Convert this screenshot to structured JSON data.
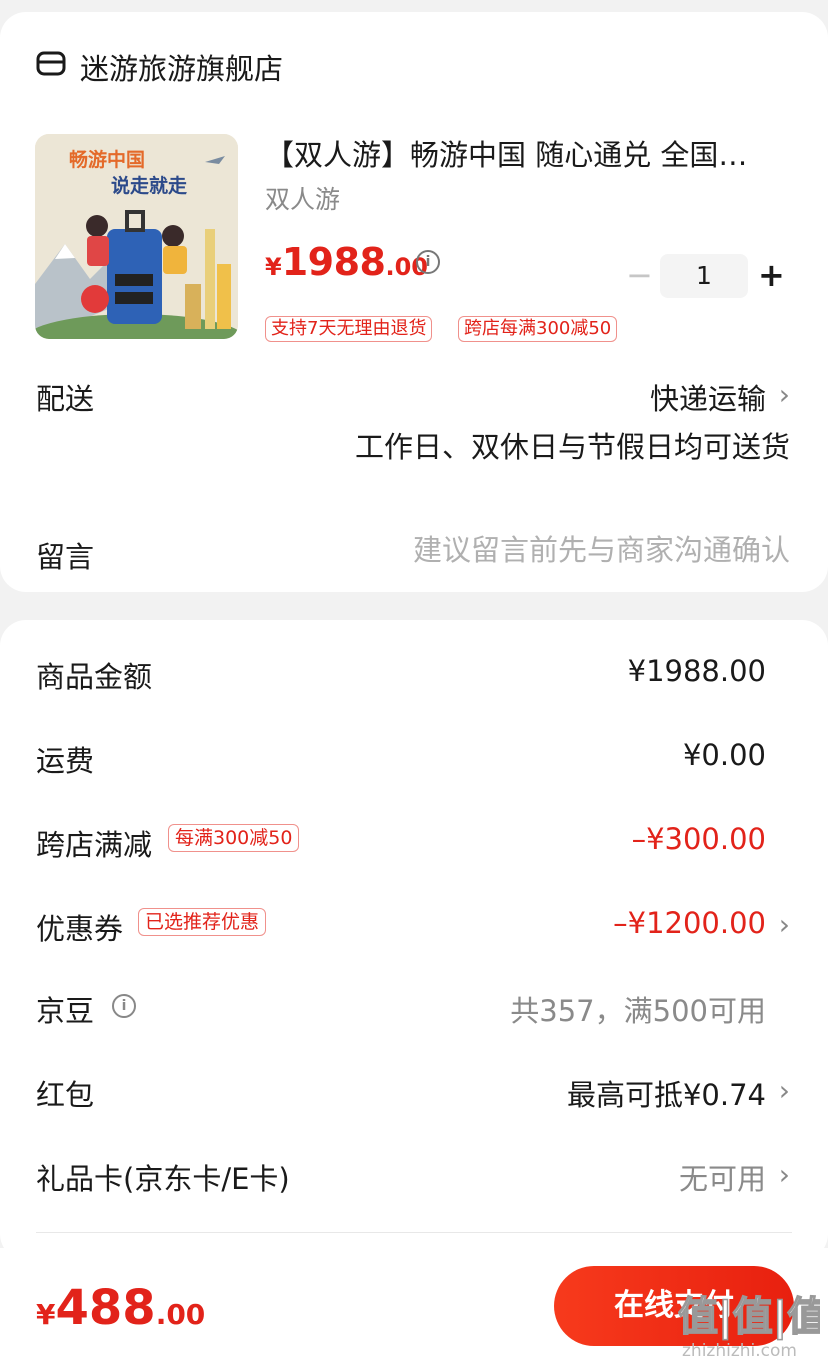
{
  "store": {
    "name": "迷游旅游旗舰店",
    "icon": "store-icon"
  },
  "product": {
    "title": "【双人游】畅游中国 随心通兑 全国…",
    "spec": "双人游",
    "price_currency": "¥",
    "price_int": "1988",
    "price_dec": ".00",
    "image_text_line1": "畅游中国",
    "image_text_line2": "说走就走",
    "quantity": "1",
    "tags": [
      "支持7天无理由退货",
      "跨店每满300减50"
    ]
  },
  "delivery": {
    "label": "配送",
    "value": "快递运输",
    "note": "工作日、双休日与节假日均可送货"
  },
  "message": {
    "label": "留言",
    "placeholder": "建议留言前先与商家沟通确认"
  },
  "summary": {
    "goods_amount": {
      "label": "商品金额",
      "value": "¥1988.00"
    },
    "shipping": {
      "label": "运费",
      "value": "¥0.00"
    },
    "cross_store": {
      "label": "跨店满减",
      "tag": "每满300减50",
      "value": "–¥300.00"
    },
    "coupon": {
      "label": "优惠券",
      "tag": "已选推荐优惠",
      "value": "–¥1200.00"
    },
    "jd_beans": {
      "label": "京豆",
      "value": "共357，满500可用"
    },
    "red_packet": {
      "label": "红包",
      "value": "最高可抵¥0.74"
    },
    "gift_card": {
      "label": "礼品卡(京东卡/E卡)",
      "value": "无可用"
    }
  },
  "footer": {
    "total_currency": "¥",
    "total_int": "488",
    "total_dec": ".00",
    "pay_button": "在线支付",
    "watermark_top": "值|值|值",
    "watermark_bottom": "zhizhizhi.com"
  },
  "colors": {
    "accent": "#e2231a",
    "background": "#f2f2f2"
  }
}
